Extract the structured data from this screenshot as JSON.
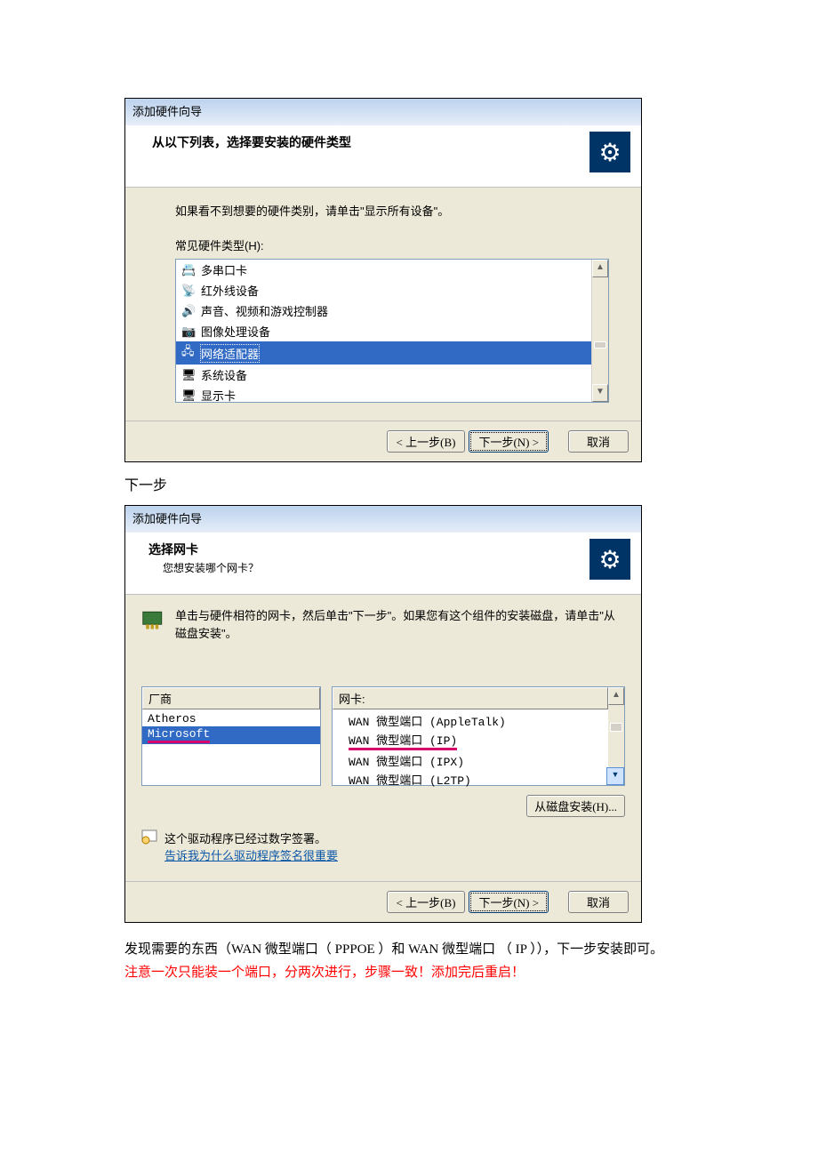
{
  "dialog1": {
    "title": "添加硬件向导",
    "heading": "从以下列表，选择要安装的硬件类型",
    "hint": "如果看不到想要的硬件类别，请单击\"显示所有设备\"。",
    "list_label": "常见硬件类型(H):",
    "items": [
      {
        "label": "多串口卡",
        "selected": false
      },
      {
        "label": "红外线设备",
        "selected": false
      },
      {
        "label": "声音、视频和游戏控制器",
        "selected": false
      },
      {
        "label": "图像处理设备",
        "selected": false
      },
      {
        "label": "网络适配器",
        "selected": true
      },
      {
        "label": "系统设备",
        "selected": false
      },
      {
        "label": "显示卡",
        "selected": false
      }
    ],
    "back": "< 上一步(B)",
    "next": "下一步(N) >",
    "cancel": "取消"
  },
  "caption1": "下一步",
  "dialog2": {
    "title": "添加硬件向导",
    "heading": "选择网卡",
    "sub": "您想安装哪个网卡？",
    "info": "单击与硬件相符的网卡，然后单击\"下一步\"。如果您有这个组件的安装磁盘，请单击\"从磁盘安装\"。",
    "col_vendor": "厂商",
    "col_card": "网卡:",
    "vendors": [
      {
        "name": "Atheros",
        "sel": false,
        "mark": false
      },
      {
        "name": "Microsoft",
        "sel": true,
        "mark": true
      }
    ],
    "cards": [
      {
        "name": "WAN 微型端口 (AppleTalk)",
        "mark": false
      },
      {
        "name": "WAN 微型端口 (IP)",
        "mark": true
      },
      {
        "name": "WAN 微型端口 (IPX)",
        "mark": false
      },
      {
        "name": "WAN 微型端口 (L2TP)",
        "mark": false
      }
    ],
    "disk_btn": "从磁盘安装(H)...",
    "signed": "这个驱动程序已经过数字签署。",
    "why_link": "告诉我为什么驱动程序签名很重要",
    "back": "< 上一步(B)",
    "next": "下一步(N) >",
    "cancel": "取消"
  },
  "para": {
    "p1a": "发现需要的东西（WAN 微型端口（ PPPOE ）和 WAN 微型端口 （ IP ）），下一步安装即可。",
    "p1b": "注意一次只能装一个端口，分两次进行，步骤一致！添加完后重启！"
  }
}
